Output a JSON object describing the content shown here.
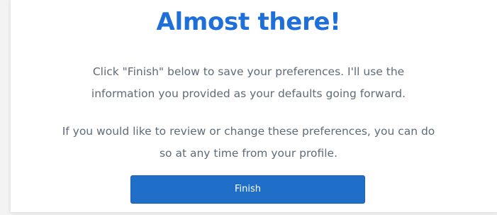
{
  "header": {
    "title": "Almost there!"
  },
  "content": {
    "paragraph_1_line_1": "Click \"Finish\" below to save your preferences. I'll use the",
    "paragraph_1_line_2": "information you provided as your defaults going forward.",
    "paragraph_2_line_1": "If you would like to review or change these preferences, you can do",
    "paragraph_2_line_2": "so at any time from your profile."
  },
  "actions": {
    "finish_label": "Finish"
  },
  "colors": {
    "title": "#1f6fdb",
    "body_text": "#5f6b76",
    "button_bg": "#1f6fc8",
    "button_text": "#ffffff"
  }
}
